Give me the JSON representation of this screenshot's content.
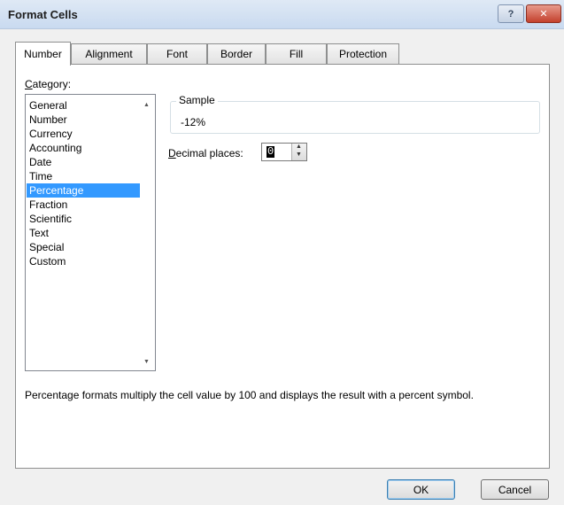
{
  "window": {
    "title": "Format Cells",
    "help_glyph": "?",
    "close_glyph": "✕"
  },
  "tabs": [
    {
      "label": "Number"
    },
    {
      "label": "Alignment"
    },
    {
      "label": "Font"
    },
    {
      "label": "Border"
    },
    {
      "label": "Fill"
    },
    {
      "label": "Protection"
    }
  ],
  "category": {
    "label_first": "C",
    "label_rest": "ategory:",
    "items": [
      "General",
      "Number",
      "Currency",
      "Accounting",
      "Date",
      "Time",
      "Percentage",
      "Fraction",
      "Scientific",
      "Text",
      "Special",
      "Custom"
    ],
    "selected": "Percentage"
  },
  "sample": {
    "title": "Sample",
    "value": "-12%"
  },
  "decimal_places": {
    "label_first": "D",
    "label_rest": "ecimal places:",
    "value": "0"
  },
  "description": "Percentage formats multiply the cell value by 100 and displays the result with a percent symbol.",
  "buttons": {
    "ok": "OK",
    "cancel": "Cancel"
  },
  "icons": {
    "scroll_up": "scroll-up-arrow-icon",
    "scroll_down": "scroll-down-arrow-icon"
  },
  "colors": {
    "selection": "#3399ff",
    "titlebar": "#dfe9f5"
  }
}
